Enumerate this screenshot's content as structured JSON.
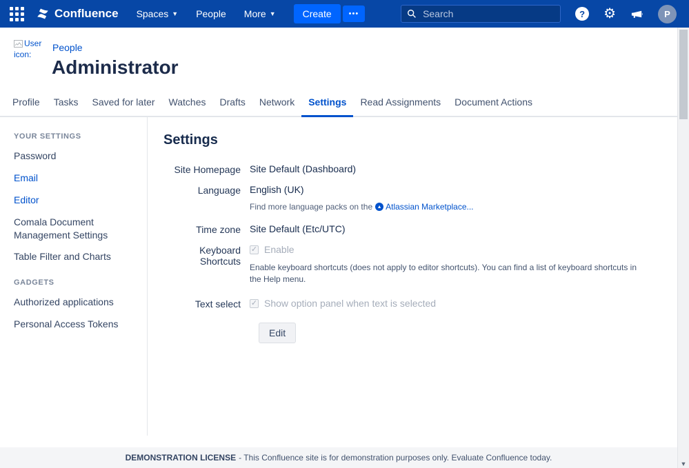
{
  "colors": {
    "nav_bg": "#0747A6",
    "button_blue": "#0065FF",
    "link_blue": "#0052CC",
    "active_tab": "#0052CC"
  },
  "topnav": {
    "brand": "Confluence",
    "menu": [
      {
        "label": "Spaces"
      },
      {
        "label": "People"
      },
      {
        "label": "More"
      }
    ],
    "create_label": "Create",
    "overflow_label": "•••",
    "search_placeholder": "Search",
    "help_label": "?",
    "avatar_initial": "P"
  },
  "header": {
    "user_image_alt": "User icon:",
    "breadcrumb": "People",
    "title": "Administrator"
  },
  "tabs": {
    "items": [
      "Profile",
      "Tasks",
      "Saved for later",
      "Watches",
      "Drafts",
      "Network",
      "Settings",
      "Read Assignments",
      "Document Actions"
    ],
    "active": "Settings"
  },
  "sidebar": {
    "sections": [
      {
        "heading": "YOUR SETTINGS",
        "items": [
          "Password",
          "Email",
          "Editor",
          "Comala Document Management Settings",
          "Table Filter and Charts"
        ]
      },
      {
        "heading": "GADGETS",
        "items": [
          "Authorized applications",
          "Personal Access Tokens"
        ]
      }
    ]
  },
  "main": {
    "title": "Settings",
    "rows": [
      {
        "label": "Site Homepage",
        "value": "Site Default (Dashboard)"
      },
      {
        "label": "Language",
        "value": "English (UK)",
        "note_prefix": "Find more language packs on the",
        "note_link": "Atlassian Marketplace..."
      },
      {
        "label": "Time zone",
        "value": "Site Default (Etc/UTC)"
      },
      {
        "label": "Keyboard Shortcuts",
        "checkbox_label": "Enable",
        "checked": true,
        "disabled": true,
        "description": "Enable keyboard shortcuts (does not apply to editor shortcuts). You can find a list of keyboard shortcuts in the Help menu."
      },
      {
        "label": "Text select",
        "checkbox_label": "Show option panel when text is selected",
        "checked": true,
        "disabled": true
      }
    ],
    "edit_label": "Edit"
  },
  "footer": {
    "bold": "DEMONSTRATION LICENSE",
    "text": "- This Confluence site is for demonstration purposes only. Evaluate Confluence today."
  }
}
